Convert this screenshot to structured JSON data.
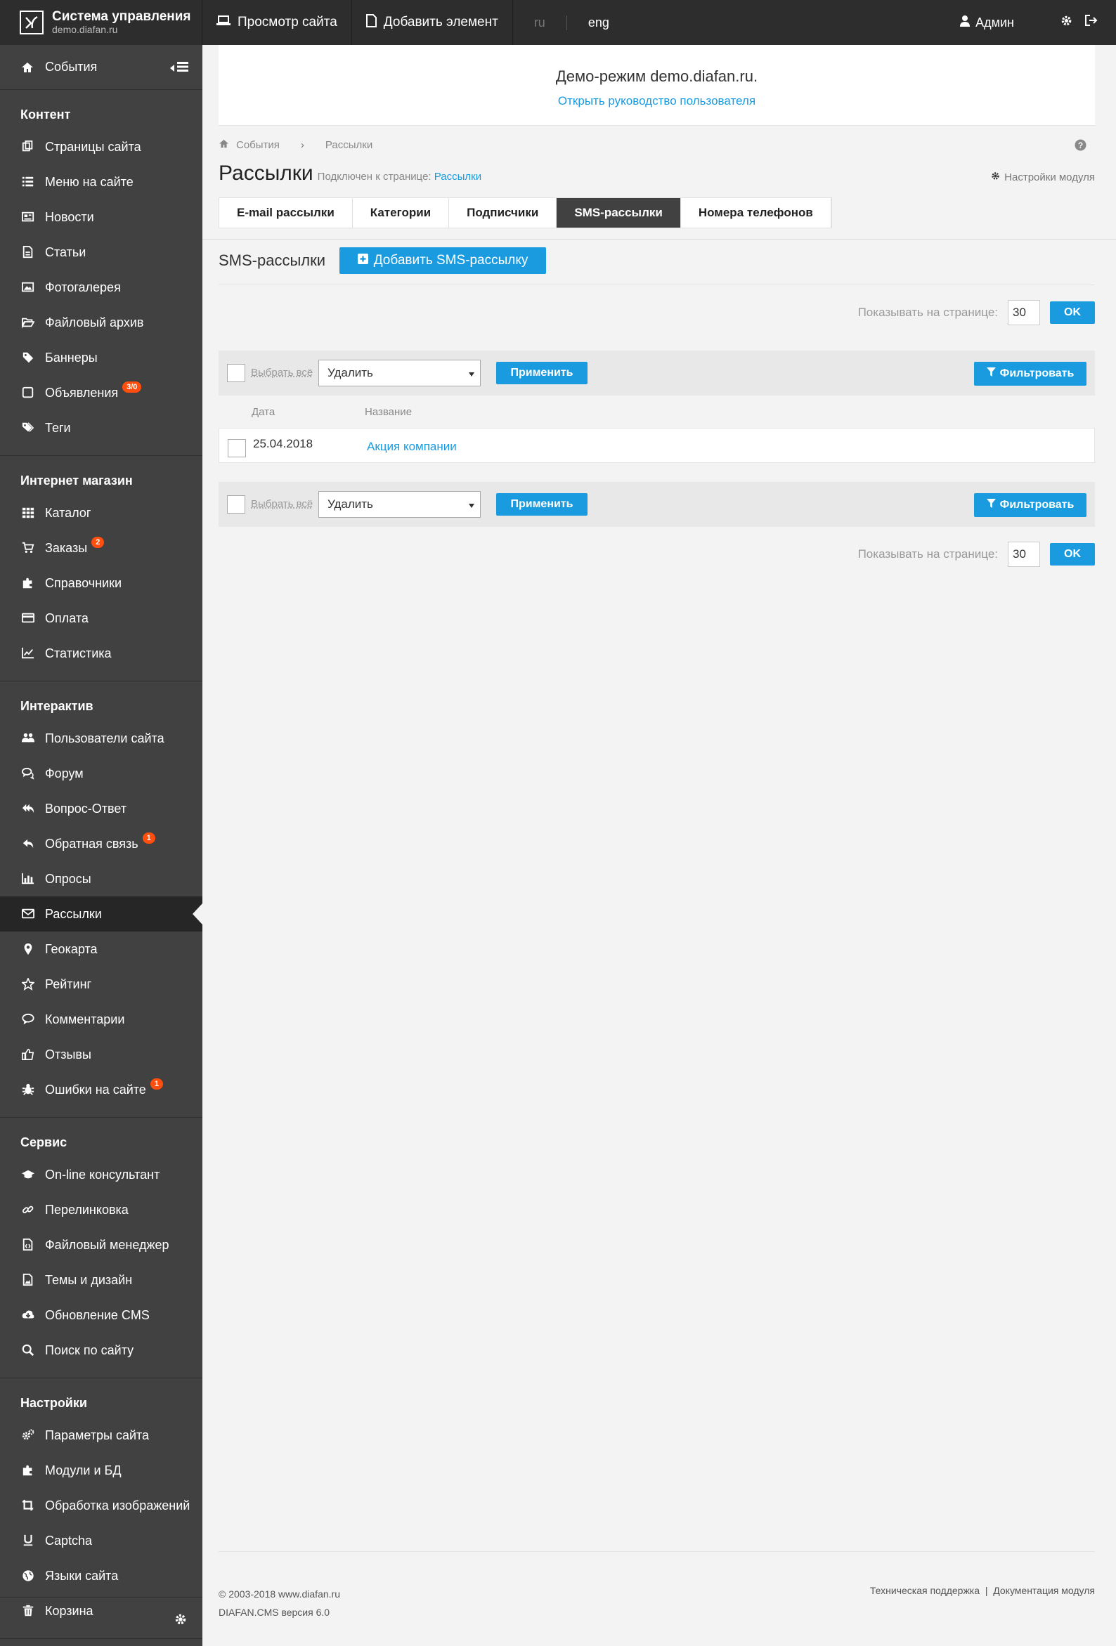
{
  "brand": {
    "title": "Система управления",
    "subtitle": "demo.diafan.ru"
  },
  "topnav": {
    "view_site": "Просмотр сайта",
    "add_element": "Добавить элемент",
    "lang_ru": "ru",
    "lang_eng": "eng",
    "user": "Админ"
  },
  "sidebar": {
    "events": "События",
    "sections": [
      {
        "title": "Контент",
        "items": [
          {
            "label": "Страницы сайта",
            "icon": "pages-icon"
          },
          {
            "label": "Меню на сайте",
            "icon": "menu-list-icon"
          },
          {
            "label": "Новости",
            "icon": "newspaper-icon"
          },
          {
            "label": "Статьи",
            "icon": "document-icon"
          },
          {
            "label": "Фотогалерея",
            "icon": "picture-icon"
          },
          {
            "label": "Файловый архив",
            "icon": "folder-open-icon"
          },
          {
            "label": "Баннеры",
            "icon": "tag-icon"
          },
          {
            "label": "Объявления",
            "icon": "note-icon",
            "badge": "3/0"
          },
          {
            "label": "Теги",
            "icon": "tags-icon"
          }
        ]
      },
      {
        "title": "Интернет магазин",
        "items": [
          {
            "label": "Каталог",
            "icon": "grid-icon"
          },
          {
            "label": "Заказы",
            "icon": "cart-icon",
            "badge": "2"
          },
          {
            "label": "Справочники",
            "icon": "puzzle-icon"
          },
          {
            "label": "Оплата",
            "icon": "credit-card-icon"
          },
          {
            "label": "Статистика",
            "icon": "line-chart-icon"
          }
        ]
      },
      {
        "title": "Интерактив",
        "items": [
          {
            "label": "Пользователи сайта",
            "icon": "users-icon"
          },
          {
            "label": "Форум",
            "icon": "comments-icon"
          },
          {
            "label": "Вопрос-Ответ",
            "icon": "reply-all-icon"
          },
          {
            "label": "Обратная связь",
            "icon": "reply-icon",
            "badge": "1"
          },
          {
            "label": "Опросы",
            "icon": "bar-chart-icon"
          },
          {
            "label": "Рассылки",
            "icon": "envelope-icon",
            "active": true
          },
          {
            "label": "Геокарта",
            "icon": "map-marker-icon"
          },
          {
            "label": "Рейтинг",
            "icon": "star-icon"
          },
          {
            "label": "Комментарии",
            "icon": "comment-icon"
          },
          {
            "label": "Отзывы",
            "icon": "thumbs-up-icon"
          },
          {
            "label": "Ошибки на сайте",
            "icon": "bug-icon",
            "badge": "1"
          }
        ]
      },
      {
        "title": "Сервис",
        "items": [
          {
            "label": "On-line консультант",
            "icon": "graduation-cap-icon"
          },
          {
            "label": "Перелинковка",
            "icon": "link-icon"
          },
          {
            "label": "Файловый менеджер",
            "icon": "file-code-icon"
          },
          {
            "label": "Темы и дизайн",
            "icon": "file-image-icon"
          },
          {
            "label": "Обновление CMS",
            "icon": "cloud-download-icon"
          },
          {
            "label": "Поиск по сайту",
            "icon": "search-icon"
          }
        ]
      },
      {
        "title": "Настройки",
        "items": [
          {
            "label": "Параметры сайта",
            "icon": "cogs-icon"
          },
          {
            "label": "Модули и БД",
            "icon": "puzzle-icon"
          },
          {
            "label": "Обработка изображений",
            "icon": "crop-icon"
          },
          {
            "label": "Captcha",
            "icon": "underline-icon"
          },
          {
            "label": "Языки сайта",
            "icon": "globe-icon"
          },
          {
            "label": "Корзина",
            "icon": "trash-icon"
          }
        ]
      }
    ]
  },
  "demo": {
    "title": "Демо-режим demo.diafan.ru.",
    "link": "Открыть руководство пользователя"
  },
  "breadcrumb": {
    "home": "События",
    "current": "Рассылки"
  },
  "page": {
    "title": "Рассылки",
    "attached_prefix": "Подключен к странице:",
    "attached_link": "Рассылки",
    "module_settings": "Настройки модуля"
  },
  "tabs": [
    "E-mail рассылки",
    "Категории",
    "Подписчики",
    "SMS-рассылки",
    "Номера телефонов"
  ],
  "active_tab": "SMS-рассылки",
  "list": {
    "label": "SMS-рассылки",
    "add_button": "Добавить SMS-рассылку"
  },
  "perpage": {
    "label": "Показывать на странице:",
    "value": "30",
    "ok": "OK"
  },
  "actions": {
    "select_all": "Выбрать всё",
    "action_value": "Удалить",
    "apply": "Применить",
    "filter": "Фильтровать"
  },
  "table": {
    "columns": [
      "Дата",
      "Название"
    ],
    "rows": [
      {
        "date": "25.04.2018",
        "name": "Акция компании"
      }
    ]
  },
  "footer": {
    "copyright": "© 2003-2018 www.diafan.ru",
    "version": "DIAFAN.CMS версия 6.0",
    "support": "Техническая поддержка",
    "sep": "|",
    "docs": "Документация модуля"
  },
  "colors": {
    "accent": "#1a9be0",
    "sidebar": "#414141",
    "topbar": "#2d2d2d",
    "badge": "#ff4e0d"
  }
}
